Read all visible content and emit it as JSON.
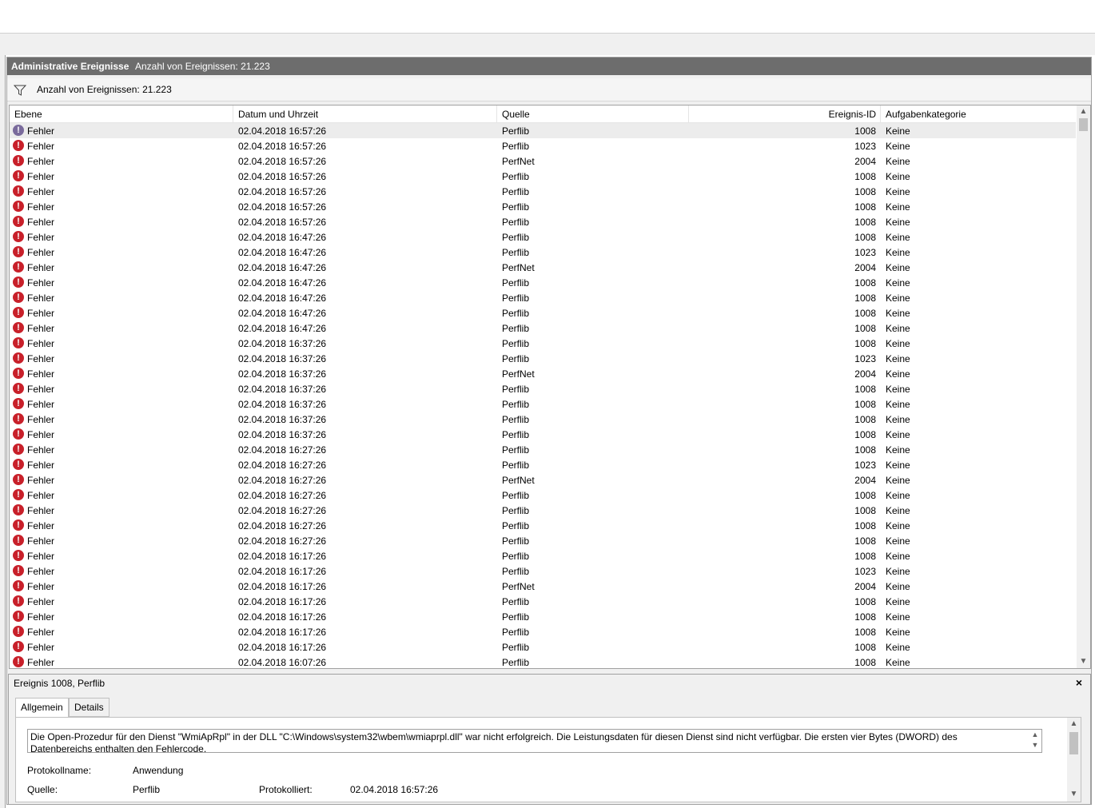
{
  "panel": {
    "title": "Administrative Ereignisse",
    "count": "Anzahl von Ereignissen: 21.223"
  },
  "filter": {
    "icon": "filter-icon",
    "text": "Anzahl von Ereignissen: 21.223"
  },
  "columns": [
    "Ebene",
    "Datum und Uhrzeit",
    "Quelle",
    "Ereignis-ID",
    "Aufgabenkategorie"
  ],
  "rows": [
    {
      "level": "Fehler",
      "date": "02.04.2018 16:57:26",
      "source": "Perflib",
      "id": "1008",
      "category": "Keine",
      "selected": true
    },
    {
      "level": "Fehler",
      "date": "02.04.2018 16:57:26",
      "source": "Perflib",
      "id": "1023",
      "category": "Keine"
    },
    {
      "level": "Fehler",
      "date": "02.04.2018 16:57:26",
      "source": "PerfNet",
      "id": "2004",
      "category": "Keine"
    },
    {
      "level": "Fehler",
      "date": "02.04.2018 16:57:26",
      "source": "Perflib",
      "id": "1008",
      "category": "Keine"
    },
    {
      "level": "Fehler",
      "date": "02.04.2018 16:57:26",
      "source": "Perflib",
      "id": "1008",
      "category": "Keine"
    },
    {
      "level": "Fehler",
      "date": "02.04.2018 16:57:26",
      "source": "Perflib",
      "id": "1008",
      "category": "Keine"
    },
    {
      "level": "Fehler",
      "date": "02.04.2018 16:57:26",
      "source": "Perflib",
      "id": "1008",
      "category": "Keine"
    },
    {
      "level": "Fehler",
      "date": "02.04.2018 16:47:26",
      "source": "Perflib",
      "id": "1008",
      "category": "Keine"
    },
    {
      "level": "Fehler",
      "date": "02.04.2018 16:47:26",
      "source": "Perflib",
      "id": "1023",
      "category": "Keine"
    },
    {
      "level": "Fehler",
      "date": "02.04.2018 16:47:26",
      "source": "PerfNet",
      "id": "2004",
      "category": "Keine"
    },
    {
      "level": "Fehler",
      "date": "02.04.2018 16:47:26",
      "source": "Perflib",
      "id": "1008",
      "category": "Keine"
    },
    {
      "level": "Fehler",
      "date": "02.04.2018 16:47:26",
      "source": "Perflib",
      "id": "1008",
      "category": "Keine"
    },
    {
      "level": "Fehler",
      "date": "02.04.2018 16:47:26",
      "source": "Perflib",
      "id": "1008",
      "category": "Keine"
    },
    {
      "level": "Fehler",
      "date": "02.04.2018 16:47:26",
      "source": "Perflib",
      "id": "1008",
      "category": "Keine"
    },
    {
      "level": "Fehler",
      "date": "02.04.2018 16:37:26",
      "source": "Perflib",
      "id": "1008",
      "category": "Keine"
    },
    {
      "level": "Fehler",
      "date": "02.04.2018 16:37:26",
      "source": "Perflib",
      "id": "1023",
      "category": "Keine"
    },
    {
      "level": "Fehler",
      "date": "02.04.2018 16:37:26",
      "source": "PerfNet",
      "id": "2004",
      "category": "Keine"
    },
    {
      "level": "Fehler",
      "date": "02.04.2018 16:37:26",
      "source": "Perflib",
      "id": "1008",
      "category": "Keine"
    },
    {
      "level": "Fehler",
      "date": "02.04.2018 16:37:26",
      "source": "Perflib",
      "id": "1008",
      "category": "Keine"
    },
    {
      "level": "Fehler",
      "date": "02.04.2018 16:37:26",
      "source": "Perflib",
      "id": "1008",
      "category": "Keine"
    },
    {
      "level": "Fehler",
      "date": "02.04.2018 16:37:26",
      "source": "Perflib",
      "id": "1008",
      "category": "Keine"
    },
    {
      "level": "Fehler",
      "date": "02.04.2018 16:27:26",
      "source": "Perflib",
      "id": "1008",
      "category": "Keine"
    },
    {
      "level": "Fehler",
      "date": "02.04.2018 16:27:26",
      "source": "Perflib",
      "id": "1023",
      "category": "Keine"
    },
    {
      "level": "Fehler",
      "date": "02.04.2018 16:27:26",
      "source": "PerfNet",
      "id": "2004",
      "category": "Keine"
    },
    {
      "level": "Fehler",
      "date": "02.04.2018 16:27:26",
      "source": "Perflib",
      "id": "1008",
      "category": "Keine"
    },
    {
      "level": "Fehler",
      "date": "02.04.2018 16:27:26",
      "source": "Perflib",
      "id": "1008",
      "category": "Keine"
    },
    {
      "level": "Fehler",
      "date": "02.04.2018 16:27:26",
      "source": "Perflib",
      "id": "1008",
      "category": "Keine"
    },
    {
      "level": "Fehler",
      "date": "02.04.2018 16:27:26",
      "source": "Perflib",
      "id": "1008",
      "category": "Keine"
    },
    {
      "level": "Fehler",
      "date": "02.04.2018 16:17:26",
      "source": "Perflib",
      "id": "1008",
      "category": "Keine"
    },
    {
      "level": "Fehler",
      "date": "02.04.2018 16:17:26",
      "source": "Perflib",
      "id": "1023",
      "category": "Keine"
    },
    {
      "level": "Fehler",
      "date": "02.04.2018 16:17:26",
      "source": "PerfNet",
      "id": "2004",
      "category": "Keine"
    },
    {
      "level": "Fehler",
      "date": "02.04.2018 16:17:26",
      "source": "Perflib",
      "id": "1008",
      "category": "Keine"
    },
    {
      "level": "Fehler",
      "date": "02.04.2018 16:17:26",
      "source": "Perflib",
      "id": "1008",
      "category": "Keine"
    },
    {
      "level": "Fehler",
      "date": "02.04.2018 16:17:26",
      "source": "Perflib",
      "id": "1008",
      "category": "Keine"
    },
    {
      "level": "Fehler",
      "date": "02.04.2018 16:17:26",
      "source": "Perflib",
      "id": "1008",
      "category": "Keine"
    },
    {
      "level": "Fehler",
      "date": "02.04.2018 16:07:26",
      "source": "Perflib",
      "id": "1008",
      "category": "Keine"
    }
  ],
  "detail": {
    "title": "Ereignis 1008, Perflib",
    "close": "×",
    "tabs": [
      "Allgemein",
      "Details"
    ],
    "message": "Die Open-Prozedur für den Dienst \"WmiApRpl\" in der DLL \"C:\\Windows\\system32\\wbem\\wmiaprpl.dll\" war nicht erfolgreich. Die Leistungsdaten für diesen Dienst sind nicht verfügbar. Die ersten vier Bytes (DWORD) des Datenbereichs enthalten den Fehlercode.",
    "log_label": "Protokollname:",
    "log_value": "Anwendung",
    "source_label": "Quelle:",
    "source_value": "Perflib",
    "logged_label": "Protokolliert:",
    "logged_value": "02.04.2018 16:57:26"
  },
  "icons": {
    "error": "error-icon",
    "filter": "filter-icon",
    "close": "close-icon"
  }
}
